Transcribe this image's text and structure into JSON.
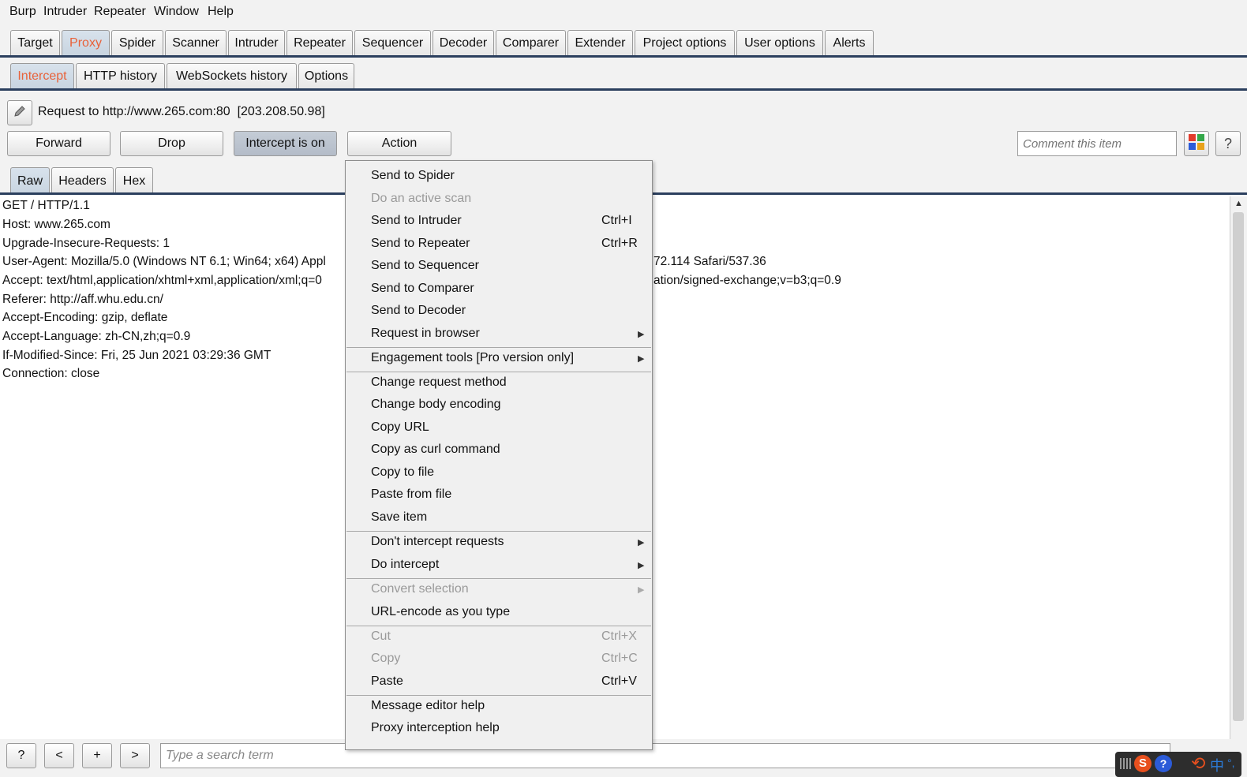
{
  "menubar": [
    "Burp",
    "Intruder",
    "Repeater",
    "Window",
    "Help"
  ],
  "main_tabs": [
    "Target",
    "Proxy",
    "Spider",
    "Scanner",
    "Intruder",
    "Repeater",
    "Sequencer",
    "Decoder",
    "Comparer",
    "Extender",
    "Project options",
    "User options",
    "Alerts"
  ],
  "proxy_tabs": [
    "Intercept",
    "HTTP history",
    "WebSockets history",
    "Options"
  ],
  "request": {
    "target": "Request to http://www.265.com:80  [203.208.50.98]"
  },
  "buttons": {
    "forward": "Forward",
    "drop": "Drop",
    "intercept": "Intercept is on",
    "action": "Action"
  },
  "comment": {
    "placeholder": "Comment this item"
  },
  "help_glyph": "?",
  "view_tabs": [
    "Raw",
    "Headers",
    "Hex"
  ],
  "request_lines": [
    "GET / HTTP/1.1",
    "Host: www.265.com",
    "Upgrade-Insecure-Requests: 1",
    "User-Agent: Mozilla/5.0 (Windows NT 6.1; Win64; x64) Appl",
    "Accept: text/html,application/xhtml+xml,application/xml;q=0",
    "Referer: http://aff.whu.edu.cn/",
    "Accept-Encoding: gzip, deflate",
    "Accept-Language: zh-CN,zh;q=0.9",
    "If-Modified-Since: Fri, 25 Jun 2021 03:29:36 GMT",
    "Connection: close"
  ],
  "request_line_tails": {
    "user_agent": "72.114 Safari/537.36",
    "accept": "ation/signed-exchange;v=b3;q=0.9"
  },
  "context_menu": [
    {
      "label": "Send to Spider",
      "shortcut": "",
      "disabled": false,
      "submenu": false
    },
    {
      "label": "Do an active scan",
      "shortcut": "",
      "disabled": true,
      "submenu": false
    },
    {
      "label": "Send to Intruder",
      "shortcut": "Ctrl+I",
      "disabled": false,
      "submenu": false
    },
    {
      "label": "Send to Repeater",
      "shortcut": "Ctrl+R",
      "disabled": false,
      "submenu": false
    },
    {
      "label": "Send to Sequencer",
      "shortcut": "",
      "disabled": false,
      "submenu": false
    },
    {
      "label": "Send to Comparer",
      "shortcut": "",
      "disabled": false,
      "submenu": false
    },
    {
      "label": "Send to Decoder",
      "shortcut": "",
      "disabled": false,
      "submenu": false
    },
    {
      "label": "Request in browser",
      "shortcut": "",
      "disabled": false,
      "submenu": true
    },
    {
      "label": "Engagement tools [Pro version only]",
      "shortcut": "",
      "disabled": false,
      "submenu": true
    },
    {
      "label": "Change request method",
      "shortcut": "",
      "disabled": false,
      "submenu": false
    },
    {
      "label": "Change body encoding",
      "shortcut": "",
      "disabled": false,
      "submenu": false
    },
    {
      "label": "Copy URL",
      "shortcut": "",
      "disabled": false,
      "submenu": false
    },
    {
      "label": "Copy as curl command",
      "shortcut": "",
      "disabled": false,
      "submenu": false
    },
    {
      "label": "Copy to file",
      "shortcut": "",
      "disabled": false,
      "submenu": false
    },
    {
      "label": "Paste from file",
      "shortcut": "",
      "disabled": false,
      "submenu": false
    },
    {
      "label": "Save item",
      "shortcut": "",
      "disabled": false,
      "submenu": false
    },
    {
      "label": "Don't intercept requests",
      "shortcut": "",
      "disabled": false,
      "submenu": true
    },
    {
      "label": "Do intercept",
      "shortcut": "",
      "disabled": false,
      "submenu": true
    },
    {
      "label": "Convert selection",
      "shortcut": "",
      "disabled": true,
      "submenu": true
    },
    {
      "label": "URL-encode as you type",
      "shortcut": "",
      "disabled": false,
      "submenu": false
    },
    {
      "label": "Cut",
      "shortcut": "Ctrl+X",
      "disabled": true,
      "submenu": false
    },
    {
      "label": "Copy",
      "shortcut": "Ctrl+C",
      "disabled": true,
      "submenu": false
    },
    {
      "label": "Paste",
      "shortcut": "Ctrl+V",
      "disabled": false,
      "submenu": false
    },
    {
      "label": "Message editor help",
      "shortcut": "",
      "disabled": false,
      "submenu": false
    },
    {
      "label": "Proxy interception help",
      "shortcut": "",
      "disabled": false,
      "submenu": false
    }
  ],
  "bottom": {
    "help": "?",
    "prev": "<",
    "add": "+",
    "next": ">",
    "search_placeholder": "Type a search term"
  },
  "tray": {
    "ime_s": "S",
    "ime_lang": "中"
  },
  "colors": {
    "active_tab_text": "#e8623a",
    "tab_rule": "#2b3f5e",
    "disabled_text": "#9a9a9a"
  }
}
